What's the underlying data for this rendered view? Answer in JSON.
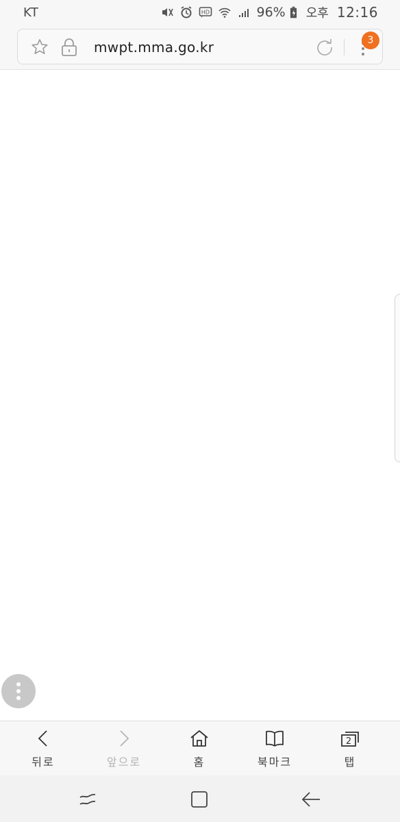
{
  "status_bar": {
    "carrier": "KT",
    "icons": [
      "mute-vibrate-icon",
      "alarm-icon",
      "hd-voice-icon",
      "wifi-icon",
      "signal-icon",
      "battery-charging-icon"
    ],
    "battery_percent": "96%",
    "ampm": "오후",
    "time": "12:16"
  },
  "browser": {
    "url": "mwpt.mma.go.kr",
    "menu_badge": "3",
    "accent_color": "#f07020"
  },
  "toolbar": {
    "back_label": "뒤로",
    "forward_label": "앞으로",
    "home_label": "홈",
    "bookmarks_label": "북마크",
    "tabs_label": "탭",
    "tab_count": "2"
  }
}
